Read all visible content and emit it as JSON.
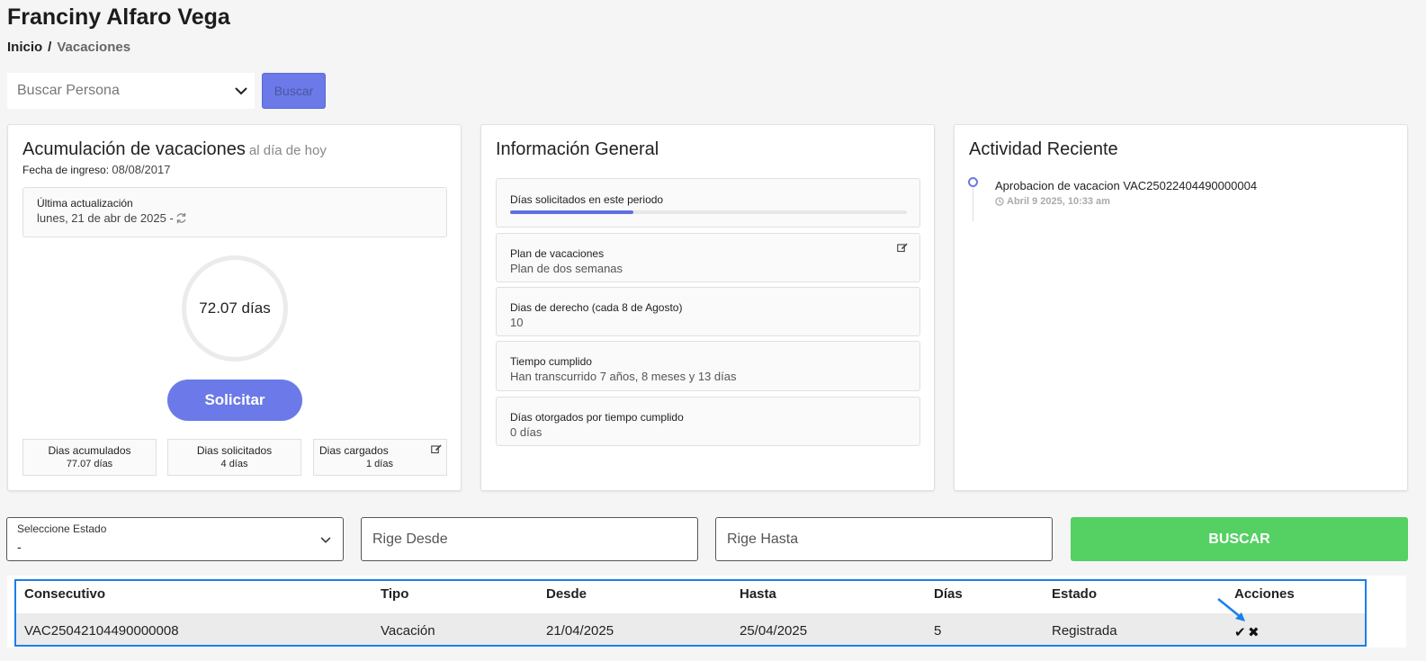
{
  "header": {
    "title": "Franciny Alfaro Vega",
    "breadcrumb": {
      "home": "Inicio",
      "separator": "/",
      "current": "Vacaciones"
    }
  },
  "search": {
    "placeholder": "Buscar Persona",
    "button_label": "Buscar"
  },
  "accumulation_card": {
    "title": "Acumulación de vacaciones",
    "subtitle": "al día de hoy",
    "start_date_label": "Fecha de ingreso:",
    "start_date_value": "08/08/2017",
    "last_update_label": "Última actualización",
    "last_update_value": "lunes, 21 de abr de 2025 -",
    "balance": "72.07 días",
    "request_button": "Solicitar",
    "stats": [
      {
        "label": "Dias acumulados",
        "value": "77.07 días"
      },
      {
        "label": "Dias solicitados",
        "value": "4 días"
      },
      {
        "label": "Dias cargados",
        "value": "1 días"
      }
    ]
  },
  "general_info_card": {
    "title": "Información General",
    "requested_label": "Días solicitados en este periodo",
    "requested_progress": 0.31,
    "items": [
      {
        "label": "Plan de vacaciones",
        "value": "Plan de dos semanas"
      },
      {
        "label": "Dias de derecho (cada 8 de Agosto)",
        "value": "10"
      },
      {
        "label": "Tiempo cumplido",
        "value": "Han transcurrido 7 años, 8 meses y 13 días"
      },
      {
        "label": "Días otorgados por tiempo cumplido",
        "value": "0 días"
      }
    ]
  },
  "activity_card": {
    "title": "Actividad Reciente",
    "items": [
      {
        "title": "Aprobacion de vacacion VAC25022404490000004",
        "time": "Abril 9 2025, 10:33 am"
      }
    ]
  },
  "filters": {
    "status_label": "Seleccione Estado",
    "status_value": "-",
    "from_placeholder": "Rige Desde",
    "to_placeholder": "Rige Hasta",
    "search_button": "BUSCAR"
  },
  "table": {
    "headers": [
      "Consecutivo",
      "Tipo",
      "Desde",
      "Hasta",
      "Días",
      "Estado",
      "Acciones"
    ],
    "rows": [
      [
        "VAC25042104490000008",
        "Vacación",
        "21/04/2025",
        "25/04/2025",
        "5",
        "Registrada"
      ]
    ],
    "actions": {
      "approve": "✔",
      "reject": "✖"
    }
  },
  "colors": {
    "accent": "#6b7ae8",
    "success": "#55d063",
    "highlight": "#1b7fe8"
  }
}
